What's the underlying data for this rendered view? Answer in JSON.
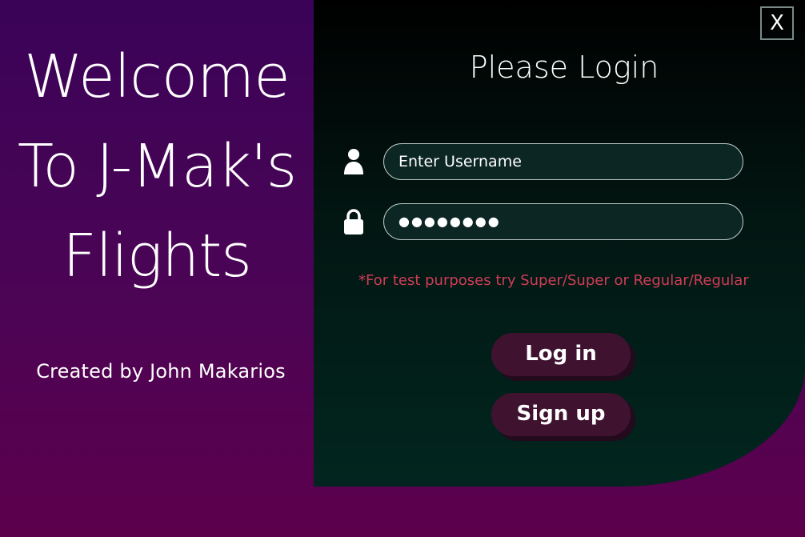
{
  "welcome": {
    "lines": [
      "Welcome",
      "To J-Mak's",
      "Flights"
    ],
    "credit": "Created by John Makarios"
  },
  "login": {
    "close_label": "X",
    "title": "Please Login",
    "username": {
      "placeholder": "Enter Username",
      "value": "",
      "icon": "user-icon"
    },
    "password": {
      "value": "●●●●●●●●",
      "icon": "lock-icon"
    },
    "hint": "*For test purposes try Super/Super or Regular/Regular",
    "login_button": "Log in",
    "signup_button": "Sign up"
  },
  "colors": {
    "background_purple": "#3a0358",
    "panel_dark": "#02261f",
    "hint_red": "#d03c56",
    "button": "#3f1330"
  }
}
